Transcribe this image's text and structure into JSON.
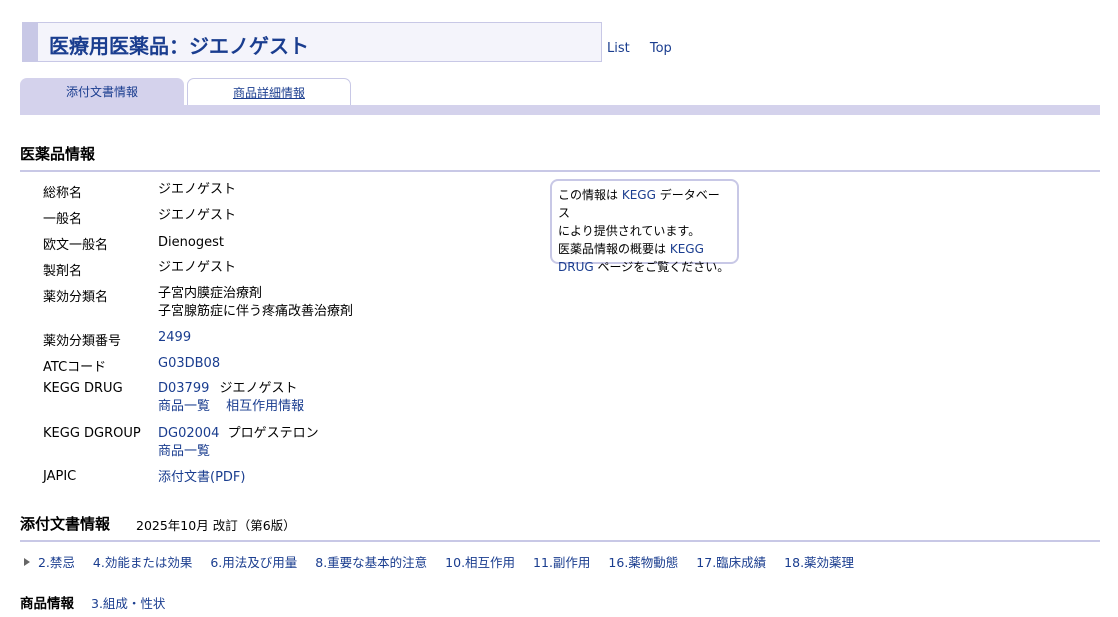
{
  "title": "医療用医薬品：ジエノゲスト",
  "top_links": [
    "List",
    "Top"
  ],
  "tabs": [
    {
      "label": "添付文書情報",
      "active": true
    },
    {
      "label": "商品詳細情報",
      "active": false
    }
  ],
  "drug_info": {
    "heading": "医薬品情報",
    "rows": [
      {
        "label": "総称名",
        "value": "ジエノゲスト"
      },
      {
        "label": "一般名",
        "value": "ジエノゲスト"
      },
      {
        "label": "欧文一般名",
        "value": "Dienogest"
      },
      {
        "label": "製剤名",
        "value": "ジエノゲスト"
      },
      {
        "label": "薬効分類名",
        "value_lines": [
          "子宮内膜症治療剤",
          "子宮腺筋症に伴う疼痛改善治療剤"
        ]
      },
      {
        "label": "薬効分類番号",
        "value": "2499"
      },
      {
        "label": "ATCコード",
        "value": "G03DB08"
      },
      {
        "label": "KEGG DRUG",
        "link": "D03799",
        "text": "ジエノゲスト",
        "links2": [
          "商品一覧",
          "相互作用情報"
        ]
      },
      {
        "label": "KEGG DGROUP",
        "link": "DG02004",
        "text": "プロゲステロン",
        "links2": [
          "商品一覧"
        ]
      },
      {
        "label": "JAPIC",
        "value": "添付文書(PDF)"
      }
    ]
  },
  "info_box": {
    "line1_pre": "この情報は ",
    "line1_link": "KEGG",
    "line1_post": " データベース",
    "line2": "により提供されています。",
    "line3_pre": "医薬品情報の概要は ",
    "line3_link": "KEGG",
    "line4_link": "DRUG",
    "line4_post": " ページをご覧ください。"
  },
  "package_insert": {
    "heading": "添付文書情報",
    "revision": "2025年10月 改訂（第6版）",
    "nav": [
      "2.禁忌",
      "4.効能または効果",
      "6.用法及び用量",
      "8.重要な基本的注意",
      "10.相互作用",
      "11.副作用",
      "16.薬物動態",
      "17.臨床成績",
      "18.薬効薬理"
    ]
  },
  "product_info": {
    "heading": "商品情報",
    "link": "3.組成・性状"
  },
  "colors": {
    "accent": "#c8c8e6",
    "tab_active": "#d4d2ec",
    "link": "#1a3d8f",
    "title": "#1a3d8f"
  }
}
